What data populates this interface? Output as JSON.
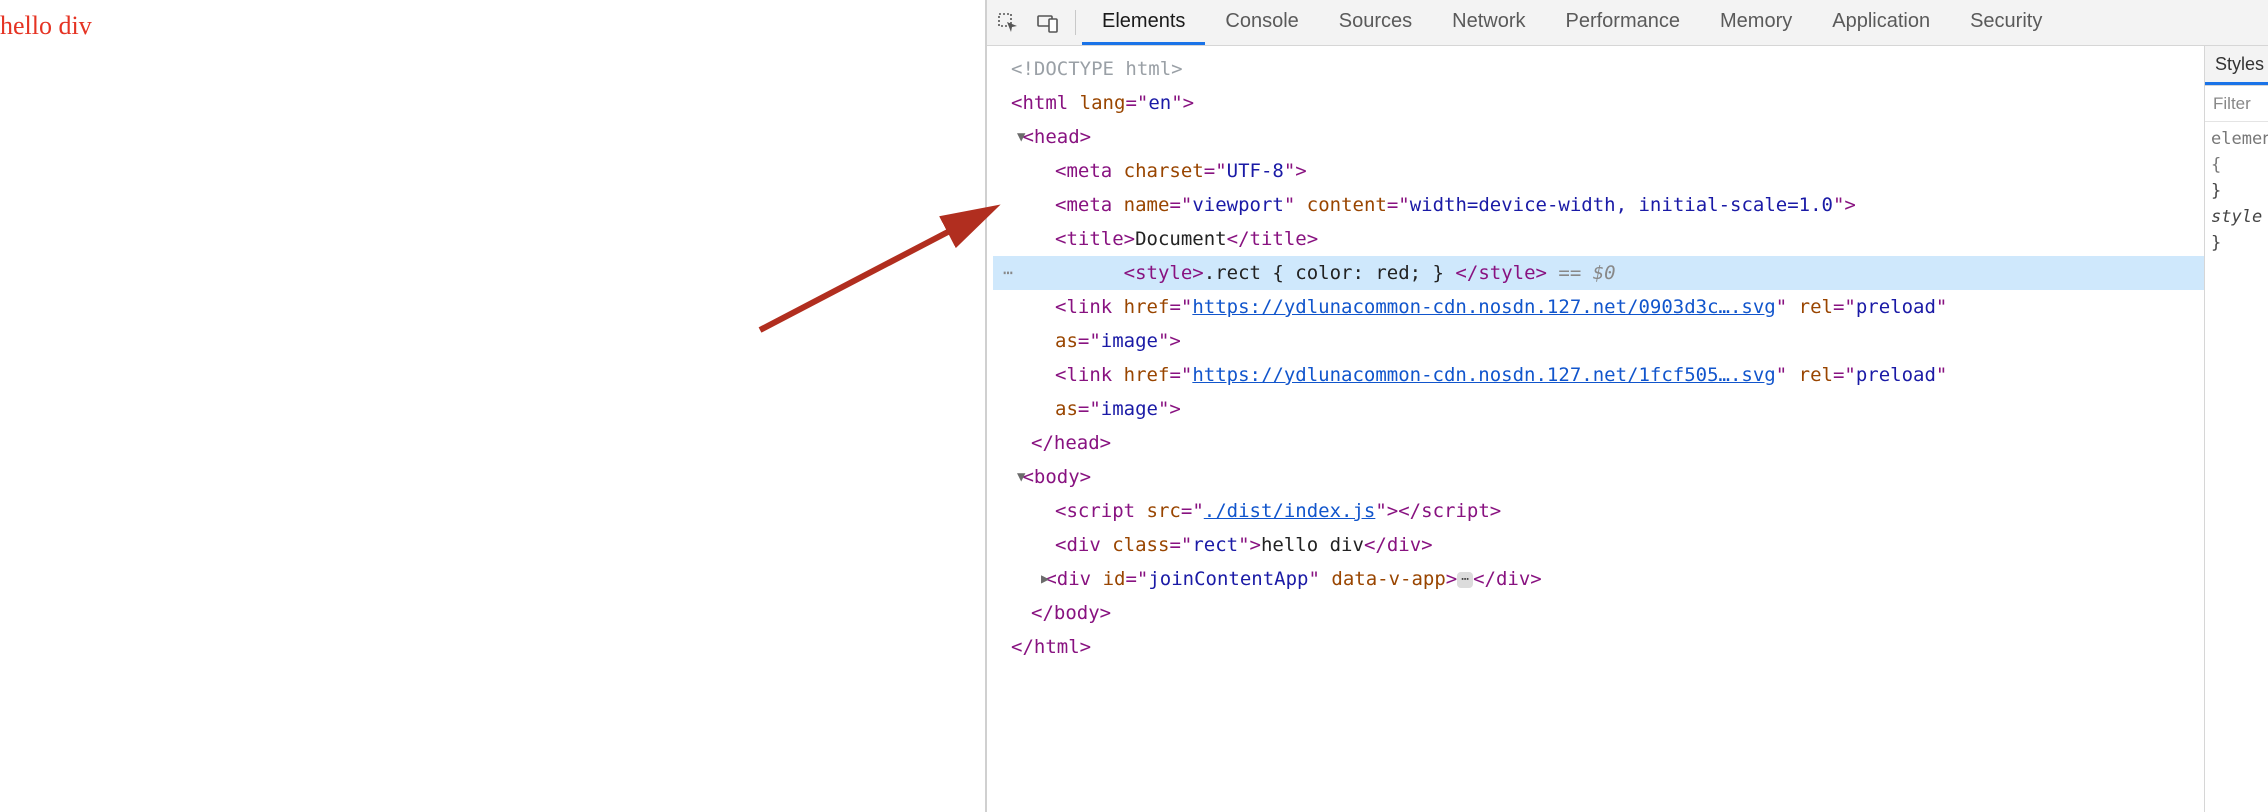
{
  "page": {
    "rendered_text": "hello div",
    "text_color": "#e53323"
  },
  "toolbar": {
    "tabs": [
      {
        "label": "Elements",
        "active": true
      },
      {
        "label": "Console",
        "active": false
      },
      {
        "label": "Sources",
        "active": false
      },
      {
        "label": "Network",
        "active": false
      },
      {
        "label": "Performance",
        "active": false
      },
      {
        "label": "Memory",
        "active": false
      },
      {
        "label": "Application",
        "active": false
      },
      {
        "label": "Security",
        "active": false
      }
    ]
  },
  "dom": {
    "doctype": "<!DOCTYPE html>",
    "html_open": {
      "tag": "html",
      "attrs": [
        [
          "lang",
          "en"
        ]
      ]
    },
    "head_open": "head",
    "meta1": {
      "tag": "meta",
      "attrs": [
        [
          "charset",
          "UTF-8"
        ]
      ]
    },
    "meta2": {
      "tag": "meta",
      "attrs": [
        [
          "name",
          "viewport"
        ],
        [
          "content",
          "width=device-width, initial-scale=1.0"
        ]
      ]
    },
    "title": {
      "tag": "title",
      "text": "Document"
    },
    "style_line": {
      "raw_prefix": "<style>",
      "content": ".rect { color: red; } ",
      "raw_suffix": "</style>",
      "eqref": "== $0"
    },
    "link1": {
      "tag": "link",
      "href": "https://ydlunacommon-cdn.nosdn.127.net/0903d3c….svg",
      "rel": "preload",
      "as": "image"
    },
    "link2": {
      "tag": "link",
      "href": "https://ydlunacommon-cdn.nosdn.127.net/1fcf505….svg",
      "rel": "preload",
      "as": "image"
    },
    "head_close": "head",
    "body_open": "body",
    "script": {
      "tag": "script",
      "src": "./dist/index.js"
    },
    "div_rect": {
      "tag": "div",
      "class": "rect",
      "text": "hello div"
    },
    "div_app": {
      "tag": "div",
      "id": "joinContentApp",
      "data-v-app": ""
    },
    "body_close": "body",
    "html_close": "html"
  },
  "styles_pane": {
    "tab": "Styles",
    "filter_placeholder": "Filter",
    "rows": [
      "element.style {",
      "}",
      "style",
      " ",
      "}"
    ]
  }
}
